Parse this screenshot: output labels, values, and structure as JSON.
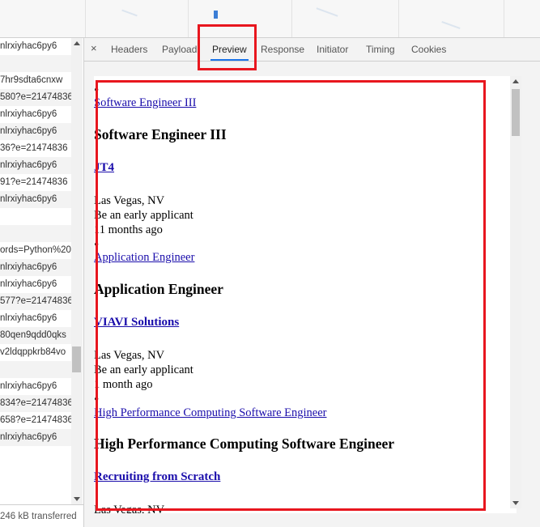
{
  "request_list": {
    "rows": [
      "nlrxiyhac6py6",
      "",
      "7hr9sdta6cnxw",
      "580?e=21474836",
      "nlrxiyhac6py6",
      "nlrxiyhac6py6",
      "36?e=21474836",
      "nlrxiyhac6py6",
      "91?e=21474836",
      "nlrxiyhac6py6",
      "",
      "",
      "ords=Python%20",
      "nlrxiyhac6py6",
      "nlrxiyhac6py6",
      "577?e=21474836",
      "nlrxiyhac6py6",
      "80qen9qdd0qks",
      "v2ldqppkrb84vo",
      "",
      "nlrxiyhac6py6",
      "834?e=21474836",
      "658?e=21474836",
      "nlrxiyhac6py6"
    ],
    "status": "246 kB transferred"
  },
  "tabs": {
    "close_symbol": "×",
    "items": [
      "Headers",
      "Payload",
      "Preview",
      "Response",
      "Initiator",
      "Timing",
      "Cookies"
    ],
    "active": "Preview"
  },
  "preview": {
    "jobs": [
      {
        "link": "Software Engineer III",
        "title": "Software Engineer III",
        "company": "JT4",
        "location": "Las Vegas, NV",
        "note": "Be an early applicant",
        "posted": "11 months ago"
      },
      {
        "link": "Application Engineer",
        "title": "Application Engineer",
        "company": "VIAVI Solutions",
        "location": "Las Vegas, NV",
        "note": "Be an early applicant",
        "posted": "1 month ago"
      },
      {
        "link": "High Performance Computing Software Engineer",
        "title": "High Performance Computing Software Engineer",
        "company": "Recruiting from Scratch",
        "location": "Las Vegas, NV"
      }
    ],
    "bullet": "•"
  },
  "colors": {
    "highlight": "#e8161e",
    "link": "#1a0dab",
    "active_tab_underline": "#1a73e8"
  }
}
